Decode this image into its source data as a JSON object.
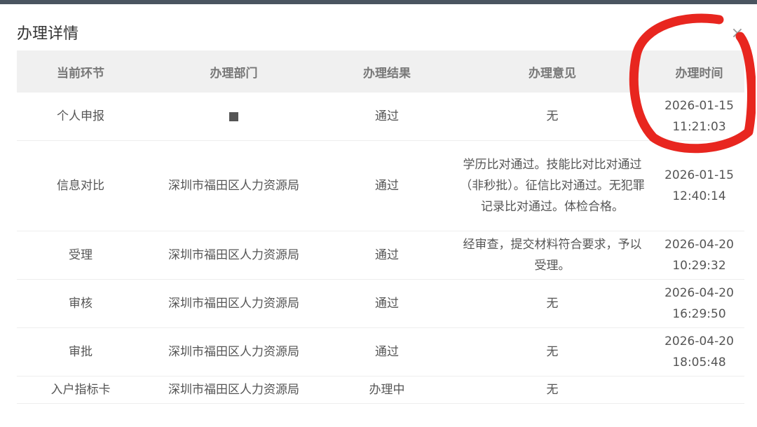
{
  "dialog": {
    "title": "办理详情",
    "close_icon": "close-icon"
  },
  "table": {
    "headers": [
      "当前环节",
      "办理部门",
      "办理结果",
      "办理意见",
      "办理时间"
    ],
    "rows": [
      {
        "step": "个人申报",
        "dept_icon": "redacted-square",
        "result": "通过",
        "opinion": "无",
        "date": "2026-01-15",
        "time": "11:21:03"
      },
      {
        "step": "信息对比",
        "dept": "深圳市福田区人力资源局",
        "result": "通过",
        "opinion": "学历比对通过。技能比对比对通过（非秒批）。征信比对通过。无犯罪记录比对通过。体检合格。",
        "date": "2026-01-15",
        "time": "12:40:14"
      },
      {
        "step": "受理",
        "dept": "深圳市福田区人力资源局",
        "result": "通过",
        "opinion": "经审查，提交材料符合要求，予以受理。",
        "date": "2026-04-20",
        "time": "10:29:32"
      },
      {
        "step": "审核",
        "dept": "深圳市福田区人力资源局",
        "result": "通过",
        "opinion": "无",
        "date": "2026-04-20",
        "time": "16:29:50"
      },
      {
        "step": "审批",
        "dept": "深圳市福田区人力资源局",
        "result": "通过",
        "opinion": "无",
        "date": "2026-04-20",
        "time": "18:05:48"
      },
      {
        "step": "入户指标卡",
        "dept": "深圳市福田区人力资源局",
        "result": "办理中",
        "opinion": "无",
        "date": "",
        "time": ""
      }
    ]
  },
  "annotation": {
    "color": "#e8261f"
  }
}
